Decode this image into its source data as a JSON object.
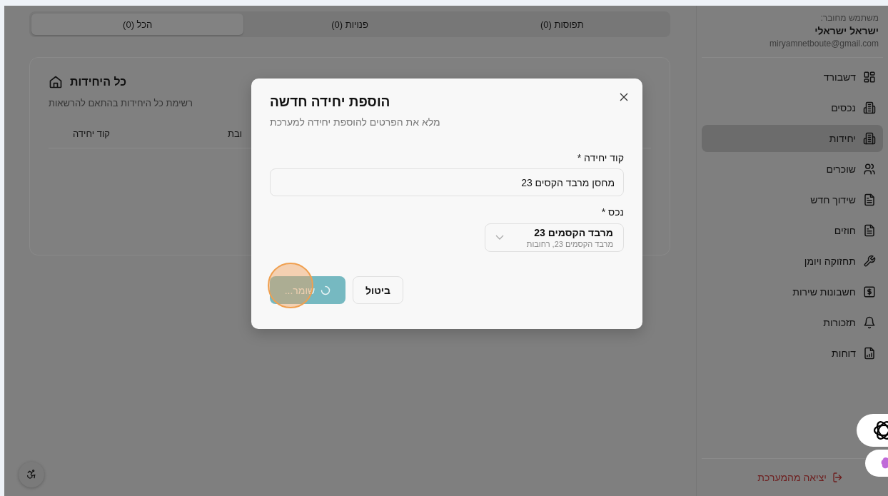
{
  "user": {
    "caption": "משתמש מחובר:",
    "name": "ישראל ישראלי",
    "email": "miryamnetboute@gmail.com"
  },
  "nav": [
    {
      "label": "דשבורד",
      "selected": false
    },
    {
      "label": "נכסים",
      "selected": false
    },
    {
      "label": "יחידות",
      "selected": true
    },
    {
      "label": "שוכרים",
      "selected": false
    },
    {
      "label": "שידוך חדש",
      "selected": false
    },
    {
      "label": "חוזים",
      "selected": false
    },
    {
      "label": "תחזוקה ויומן",
      "selected": false
    },
    {
      "label": "חשבונות שירות",
      "selected": false
    },
    {
      "label": "תזכורות",
      "selected": false
    },
    {
      "label": "דוחות",
      "selected": false
    }
  ],
  "logout": "יציאה מהמערכת",
  "tabs": [
    {
      "label": "תפוסות (0)",
      "selected": false
    },
    {
      "label": "פנויות (0)",
      "selected": false
    },
    {
      "label": "הכל (0)",
      "selected": true
    }
  ],
  "card": {
    "title": "כל היחידות",
    "subtitle": "רשימת כל היחידות בהתאם להרשאות",
    "columns": [
      "ובת",
      "קוד יחידה"
    ]
  },
  "dialog": {
    "title": "הוספת יחידה חדשה",
    "subtitle": "מלא את הפרטים להוספת יחידה למערכת",
    "unit_code": {
      "label": "קוד יחידה *",
      "value": "מחסן מרבד הקסים 23"
    },
    "property": {
      "label": "נכס *",
      "value": "מרבד הקסמים 23",
      "detail": "מרבד הקסמים 23, רחובות"
    },
    "cancel": "ביטול",
    "save": {
      "label": "שומר...",
      "loading": true
    }
  }
}
